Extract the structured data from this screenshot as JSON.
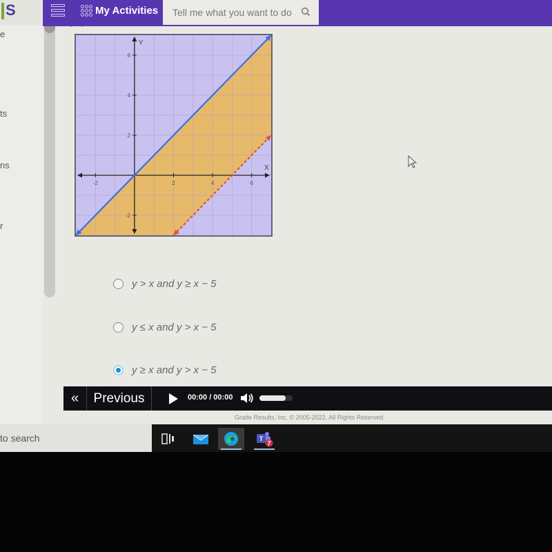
{
  "app": {
    "logo_letter": "S",
    "menu_label": "Menu",
    "activities_label": "My Activities",
    "search_placeholder": "Tell me what you want to do"
  },
  "left_nav": {
    "fragments": [
      "e",
      "ts",
      "ns",
      "r"
    ]
  },
  "question": {
    "caption_fragment": "graph."
  },
  "chart_data": {
    "type": "line",
    "title": "",
    "xlabel": "X",
    "ylabel": "Y",
    "xlim": [
      -3,
      7
    ],
    "ylim": [
      -3,
      7
    ],
    "x_ticks": [
      -2,
      2,
      4,
      6
    ],
    "y_ticks": [
      -2,
      2,
      4,
      6
    ],
    "grid": true,
    "series": [
      {
        "name": "y = x",
        "equation": "y = x",
        "slope": 1,
        "intercept": 0,
        "style": "solid",
        "color": "#3a6fe0",
        "points": [
          [
            -3,
            -3
          ],
          [
            7,
            7
          ]
        ]
      },
      {
        "name": "y = x - 5",
        "equation": "y = x - 5",
        "slope": 1,
        "intercept": -5,
        "style": "dashed",
        "color": "#e0503a",
        "points": [
          [
            2,
            -3
          ],
          [
            7,
            2
          ]
        ]
      }
    ],
    "shaded_regions": [
      {
        "name": "between-lines",
        "description": "x - 5 < y <= x",
        "color": "#e7b96a"
      },
      {
        "name": "outside",
        "color": "#c9c2f0"
      }
    ]
  },
  "options": [
    {
      "label": "y > x and y ≥ x − 5",
      "selected": false
    },
    {
      "label": "y ≤ x and y > x − 5",
      "selected": false
    },
    {
      "label": "y ≥ x and y > x − 5",
      "selected": true
    }
  ],
  "player": {
    "first_label": "«",
    "previous_label": "Previous",
    "time_current": "00:00",
    "time_total": "00:00",
    "time_text": "00:00 / 00:00",
    "volume_fraction": 0.8
  },
  "footer": {
    "copyright": "Grade Results, Inc. © 2005-2022. All Rights Reserved."
  },
  "taskbar": {
    "search_text": "to search",
    "apps": [
      "task-view",
      "mail",
      "edge",
      "teams"
    ],
    "teams_badge": "7"
  }
}
